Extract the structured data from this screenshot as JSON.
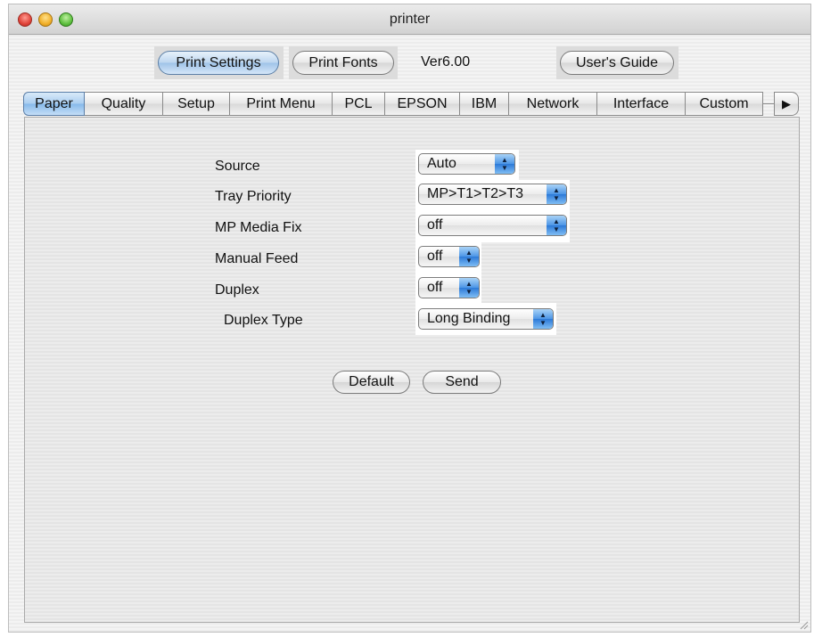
{
  "window": {
    "title": "printer"
  },
  "toolbar": {
    "print_settings_label": "Print Settings",
    "print_fonts_label": "Print Fonts",
    "version": "Ver6.00",
    "users_guide_label": "User's Guide"
  },
  "tabs": {
    "items": [
      "Paper",
      "Quality",
      "Setup",
      "Print Menu",
      "PCL",
      "EPSON",
      "IBM",
      "Network",
      "Interface",
      "Custom"
    ],
    "selected": "Paper",
    "more_icon": "triangle-right-icon"
  },
  "paper": {
    "fields": [
      {
        "label": "Source",
        "value": "Auto"
      },
      {
        "label": "Tray Priority",
        "value": "MP>T1>T2>T3"
      },
      {
        "label": "MP Media Fix",
        "value": "off"
      },
      {
        "label": "Manual Feed",
        "value": "off"
      },
      {
        "label": "Duplex",
        "value": "off"
      },
      {
        "label": "Duplex Type",
        "value": "Long Binding"
      }
    ],
    "default_label": "Default",
    "send_label": "Send"
  },
  "colors": {
    "accent": "#4c95e6",
    "selected_tab": "#a9cdf0"
  }
}
